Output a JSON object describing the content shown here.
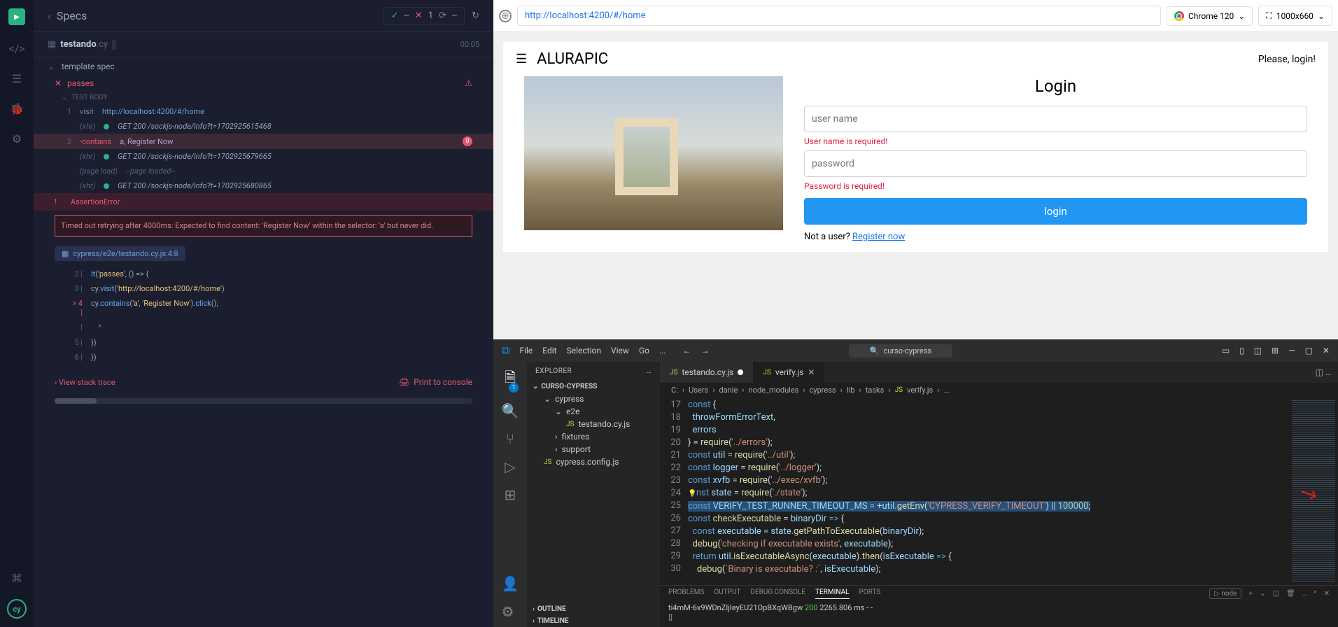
{
  "cypress": {
    "header": {
      "title": "Specs",
      "failCount": "1"
    },
    "spec": {
      "filename": "testando",
      "ext": ".cy",
      "duration": "00:05"
    },
    "tree": {
      "template": "template spec",
      "testName": "passes",
      "body": "TEST BODY"
    },
    "commands": {
      "c1": {
        "num": "1",
        "name": "visit",
        "args": "http://localhost:4200/#/home"
      },
      "xhr1": {
        "tag": "(xhr)",
        "req": "GET 200 /sockjs-node/info?t=1702925615468"
      },
      "c2": {
        "num": "2",
        "name": "-contains",
        "args": "a, Register Now",
        "pin": "0"
      },
      "xhr2": {
        "tag": "(xhr)",
        "req": "GET 200 /sockjs-node/info?t=1702925679665"
      },
      "pl": {
        "tag": "(page load)",
        "msg": "--page loaded--"
      },
      "xhr3": {
        "tag": "(xhr)",
        "req": "GET 200 /sockjs-node/info?t=1702925680865"
      }
    },
    "error": {
      "label": "AssertionError",
      "msg": "Timed out retrying after 4000ms: Expected to find content: 'Register Now' within the selector: 'a' but never did.",
      "file": "cypress/e2e/testando.cy.js:4:8"
    },
    "code": {
      "l2": "it('passes', () => {",
      "l3": "    cy.visit('http://localhost:4200/#/home')",
      "l4": "    cy.contains('a', 'Register Now').click();",
      "l5": "  })",
      "l6": "})"
    },
    "footer": {
      "stack": "View stack trace",
      "print": "Print to console"
    }
  },
  "browser": {
    "url": "http://localhost:4200/#/home",
    "chrome": "Chrome 120",
    "viewport": "1000x660"
  },
  "app": {
    "title": "ALURAPIC",
    "pleaseLogin": "Please, login!",
    "loginHeading": "Login",
    "userPlaceholder": "user name",
    "userErr": "User name is required!",
    "passPlaceholder": "password",
    "passErr": "Password is required!",
    "loginBtn": "login",
    "notUser": "Not a user? ",
    "registerNow": "Register now"
  },
  "vscode": {
    "menu": {
      "file": "File",
      "edit": "Edit",
      "selection": "Selection",
      "view": "View",
      "go": "Go",
      "more": "..."
    },
    "search": "curso-cypress",
    "sidebar": {
      "title": "EXPLORER",
      "project": "CURSO-CYPRESS",
      "cypress": "cypress",
      "e2e": "e2e",
      "testando": "testando.cy.js",
      "fixtures": "fixtures",
      "support": "support",
      "config": "cypress.config.js",
      "outline": "OUTLINE",
      "timeline": "TIMELINE"
    },
    "tabs": {
      "t1": "testando.cy.js",
      "t2": "verify.js"
    },
    "breadcrumb": {
      "c": "C:",
      "users": "Users",
      "danie": "danie",
      "nm": "node_modules",
      "cy": "cypress",
      "lib": "lib",
      "tasks": "tasks",
      "file": "verify.js",
      "more": "..."
    },
    "lineNums": {
      "l17": "17",
      "l18": "18",
      "l19": "19",
      "l20": "20",
      "l21": "21",
      "l22": "22",
      "l23": "23",
      "l24": "24",
      "l25": "25",
      "l26": "26",
      "l27": "27",
      "l28": "28",
      "l29": "29",
      "l30": "30"
    },
    "code": {
      "l17": "const {",
      "l18": "  throwFormErrorText,",
      "l19": "  errors",
      "l20": "} = require('../errors');",
      "l21": "const util = require('../util');",
      "l22": "const logger = require('../logger');",
      "l23": "const xvfb = require('../exec/xvfb');",
      "l24": "const state = require('./state');",
      "l25": "const VERIFY_TEST_RUNNER_TIMEOUT_MS = +util.getEnv('CYPRESS_VERIFY_TIMEOUT') || 100000;",
      "l26": "const checkExecutable = binaryDir => {",
      "l27": "  const executable = state.getPathToExecutable(binaryDir);",
      "l28": "  debug('checking if executable exists', executable);",
      "l29": "  return util.isExecutableAsync(executable).then(isExecutable => {",
      "l30": "    debug(`Binary is executable? :`, isExecutable);"
    },
    "terminal": {
      "tabs": {
        "problems": "PROBLEMS",
        "output": "OUTPUT",
        "debug": "DEBUG CONSOLE",
        "terminal": "TERMINAL",
        "ports": "PORTS"
      },
      "shell": "node",
      "line1a": "ti4mM-6x9WDnZIjIeyEU21OpBXqWBgw ",
      "line1b": "200",
      "line1c": " 2265.806 ms - -",
      "prompt": "▯"
    },
    "activityBadge": "1"
  }
}
